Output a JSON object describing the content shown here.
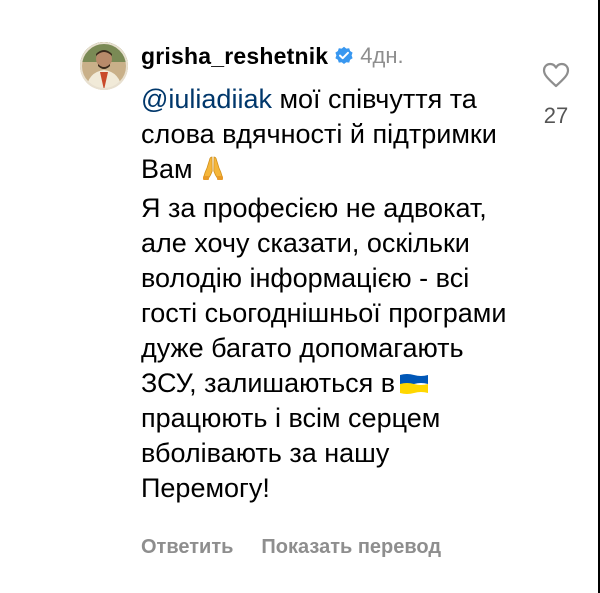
{
  "comment": {
    "username": "grisha_reshetnik",
    "time": "4дн.",
    "mention": "@iuliadiiak",
    "line1_text": " мої співчуття та слова вдячності й підтримки Вам",
    "line1_emoji": "🙏",
    "line2_before_flag": "Я за професією не адвокат, але хочу сказати, оскільки володію інформацією - всі гості сьогоднішньої програми дуже багато допомагають ЗСУ, залишаються в",
    "line2_after_flag": " працюють і всім серцем вболівають за нашу Перемогу!",
    "flag_emoji": "🇺🇦"
  },
  "actions": {
    "reply_label": "Ответить",
    "translate_label": "Показать перевод"
  },
  "likes": {
    "count": "27"
  },
  "colors": {
    "mention": "#00376b",
    "verified": "#3897f0",
    "muted": "#8e8e8e",
    "flag_blue": "#0057b7",
    "flag_yellow": "#ffd700"
  },
  "icons": {
    "verified": "verified-badge-icon",
    "heart": "heart-outline-icon"
  }
}
